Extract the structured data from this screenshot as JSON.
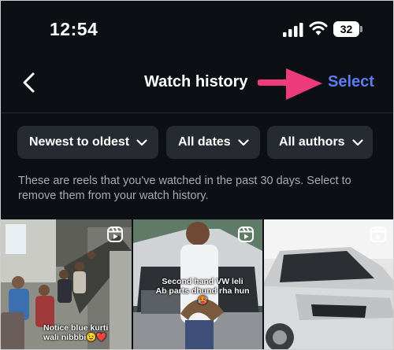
{
  "status_bar": {
    "time": "12:54",
    "battery": "32"
  },
  "header": {
    "title": "Watch history",
    "select_label": "Select"
  },
  "filters": [
    {
      "label": "Newest to oldest"
    },
    {
      "label": "All dates"
    },
    {
      "label": "All authors"
    }
  ],
  "description": "These are reels that you've watched in the past 30 days. Select to remove them from your watch history.",
  "reels": [
    {
      "caption_lines": [
        "Notice blue kurti",
        "wali nibbbi😉❤️"
      ]
    },
    {
      "caption_lines": [
        "Second hand VW leli",
        "Ab parts dhund rha hun🥵"
      ]
    },
    {
      "caption_lines": []
    }
  ],
  "colors": {
    "background": "#0c0f14",
    "accent": "#5b7cf4",
    "arrow": "#ee3b7b",
    "chip": "#262a31"
  },
  "icons": [
    "signal-icon",
    "wifi-icon",
    "battery-icon",
    "back-chevron-icon",
    "chevron-down-icon",
    "reels-icon"
  ]
}
